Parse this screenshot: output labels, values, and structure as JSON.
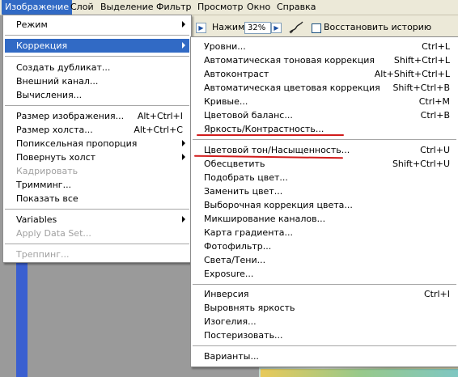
{
  "menubar": {
    "items": [
      {
        "label": "Изображение",
        "active": true
      },
      {
        "label": "Слой"
      },
      {
        "label": "Выделение"
      },
      {
        "label": "Фильтр"
      },
      {
        "label": "Просмотр"
      },
      {
        "label": "Окно"
      },
      {
        "label": "Справка"
      }
    ]
  },
  "toolbar": {
    "flow_label": "Нажим:",
    "zoom_value": "32%",
    "restore_history_label": "Восстановить историю",
    "restore_history_checked": false
  },
  "image_menu": {
    "items": [
      {
        "label": "Режим",
        "submenu": true
      },
      {
        "label": "Коррекция",
        "submenu": true,
        "selected": true
      },
      {
        "label": "Создать дубликат..."
      },
      {
        "label": "Внешний канал..."
      },
      {
        "label": "Вычисления..."
      },
      {
        "label": "Размер изображения...",
        "shortcut": "Alt+Ctrl+I"
      },
      {
        "label": "Размер холста...",
        "shortcut": "Alt+Ctrl+C"
      },
      {
        "label": "Попиксельная пропорция",
        "submenu": true
      },
      {
        "label": "Повернуть холст",
        "submenu": true
      },
      {
        "label": "Кадрировать",
        "disabled": true
      },
      {
        "label": "Тримминг..."
      },
      {
        "label": "Показать все"
      },
      {
        "label": "Variables",
        "submenu": true
      },
      {
        "label": "Apply Data Set...",
        "disabled": true
      },
      {
        "label": "Треппинг...",
        "disabled": true
      }
    ]
  },
  "adjustments_menu": {
    "items": [
      {
        "label": "Уровни...",
        "shortcut": "Ctrl+L"
      },
      {
        "label": "Автоматическая тоновая коррекция",
        "shortcut": "Shift+Ctrl+L"
      },
      {
        "label": "Автоконтраст",
        "shortcut": "Alt+Shift+Ctrl+L"
      },
      {
        "label": "Автоматическая цветовая коррекция",
        "shortcut": "Shift+Ctrl+B"
      },
      {
        "label": "Кривые...",
        "shortcut": "Ctrl+M"
      },
      {
        "label": "Цветовой баланс...",
        "shortcut": "Ctrl+B"
      },
      {
        "label": "Яркость/Контрастность..."
      },
      {
        "label": "Цветовой тон/Насыщенность...",
        "shortcut": "Ctrl+U"
      },
      {
        "label": "Обесцветить",
        "shortcut": "Shift+Ctrl+U"
      },
      {
        "label": "Подобрать цвет..."
      },
      {
        "label": "Заменить цвет..."
      },
      {
        "label": "Выборочная коррекция цвета..."
      },
      {
        "label": "Микширование каналов..."
      },
      {
        "label": "Карта градиента..."
      },
      {
        "label": "Фотофильтр..."
      },
      {
        "label": "Света/Тени..."
      },
      {
        "label": "Exposure..."
      },
      {
        "label": "Инверсия",
        "shortcut": "Ctrl+I"
      },
      {
        "label": "Выровнять яркость"
      },
      {
        "label": "Изогелия..."
      },
      {
        "label": "Постеризовать..."
      },
      {
        "label": "Варианты..."
      }
    ]
  },
  "annotation_color": "#d11b1b"
}
